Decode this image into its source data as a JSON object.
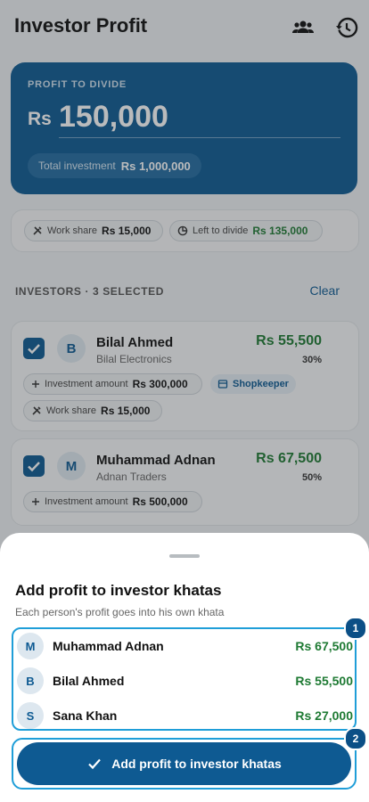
{
  "app": {
    "title": "Investor Profit"
  },
  "hero": {
    "label": "PROFIT TO DIVIDE",
    "currency": "Rs",
    "amount": "150,000",
    "total_label": "Total investment",
    "total_value": "Rs 1,000,000"
  },
  "share": {
    "work_label": "Work share",
    "work_value": "Rs 15,000",
    "left_label": "Left to divide",
    "left_value": "Rs 135,000"
  },
  "investors": {
    "section_label": "INVESTORS · 3 SELECTED",
    "clear_label": "Clear",
    "cards": [
      {
        "initial": "B",
        "name": "Bilal Ahmed",
        "business": "Bilal Electronics",
        "profit": "Rs 55,500",
        "percent": "30%",
        "inv_label": "Investment amount",
        "inv_value": "Rs 300,000",
        "role": "Shopkeeper",
        "work_label": "Work share",
        "work_value": "Rs 15,000"
      },
      {
        "initial": "M",
        "name": "Muhammad Adnan",
        "business": "Adnan Traders",
        "profit": "Rs 67,500",
        "percent": "50%",
        "inv_label": "Investment amount",
        "inv_value": "Rs 500,000"
      }
    ]
  },
  "sheet": {
    "title": "Add profit to investor khatas",
    "subtitle": "Each person's profit goes into his own khata",
    "rows": [
      {
        "initial": "M",
        "name": "Muhammad Adnan",
        "amount": "Rs 67,500"
      },
      {
        "initial": "B",
        "name": "Bilal Ahmed",
        "amount": "Rs 55,500"
      },
      {
        "initial": "S",
        "name": "Sana Khan",
        "amount": "Rs 27,000"
      }
    ],
    "button_label": "Add profit to investor khatas",
    "badge_1": "1",
    "badge_2": "2"
  },
  "colors": {
    "primary": "#0e5a92",
    "profit_green": "#1e7a33",
    "highlight": "#1f9ed8"
  },
  "icons": [
    "people-icon",
    "history-icon",
    "tools-icon",
    "pie-icon",
    "plus-icon",
    "store-icon",
    "check-icon"
  ]
}
